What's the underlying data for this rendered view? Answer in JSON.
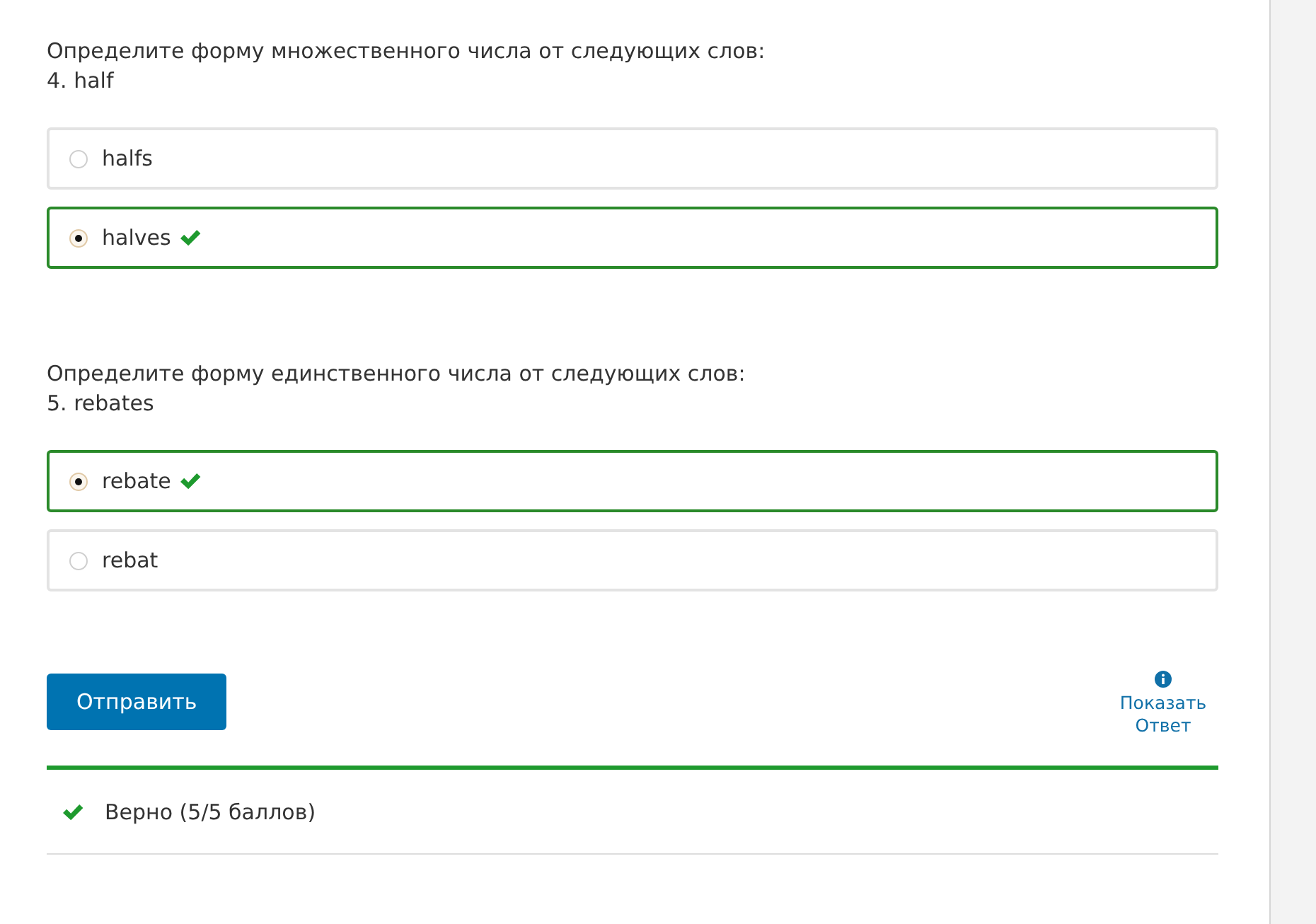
{
  "questions": [
    {
      "prompt": "Определите форму множественного числа от следующих слов:",
      "word": "4. half",
      "options": [
        {
          "label": "halfs",
          "selected": false
        },
        {
          "label": "halves",
          "selected": true,
          "correct": true
        }
      ]
    },
    {
      "prompt": "Определите форму единственного числа от следующих слов:",
      "word": "5. rebates",
      "options": [
        {
          "label": "rebate",
          "selected": true,
          "correct": true
        },
        {
          "label": "rebat",
          "selected": false
        }
      ]
    }
  ],
  "submit_button": "Отправить",
  "show_answer": "Показать Ответ",
  "feedback": {
    "text": "Верно (5/5 баллов)",
    "correct": true
  }
}
